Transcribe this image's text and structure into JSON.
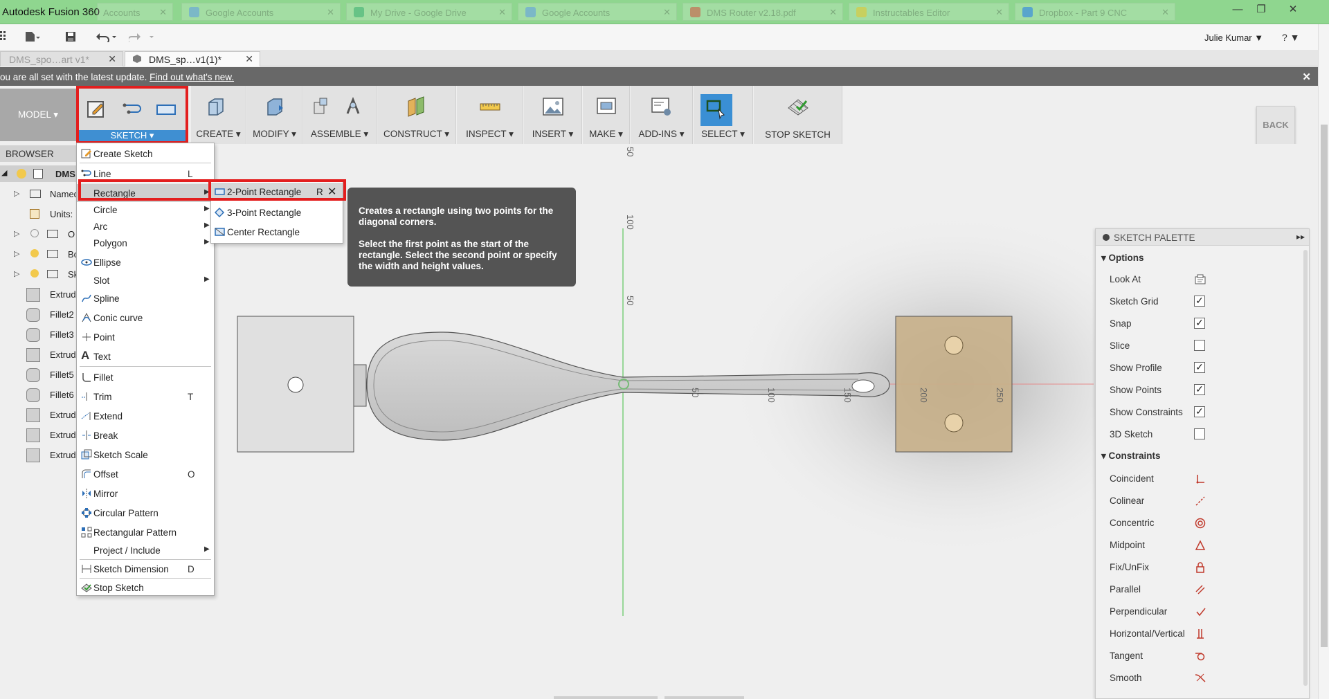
{
  "app": {
    "title": "Autodesk Fusion 360"
  },
  "browser_tabs": [
    {
      "label": "Accounts"
    },
    {
      "label": "Google Accounts"
    },
    {
      "label": "My Drive - Google Drive"
    },
    {
      "label": "Google Accounts"
    },
    {
      "label": "DMS Router v2.18.pdf"
    },
    {
      "label": "Instructables Editor"
    },
    {
      "label": "Dropbox - Part 9 CNC"
    }
  ],
  "window_buttons": {
    "minimize": "—",
    "restore": "❐",
    "close": "✕"
  },
  "quick_access": {
    "user": "Julie Kumar ▼",
    "help": "? ▼"
  },
  "document_tabs": [
    {
      "label": "DMS_spo…art v1*",
      "active": false
    },
    {
      "label": "DMS_sp…v1(1)*",
      "active": true
    }
  ],
  "notification": {
    "text": "ou are all set with the latest update.",
    "link": "Find out what's new."
  },
  "toolbar": {
    "workspace": "MODEL ▾",
    "groups": [
      {
        "id": "sketch",
        "label": "SKETCH ▾"
      },
      {
        "id": "create",
        "label": "CREATE ▾"
      },
      {
        "id": "modify",
        "label": "MODIFY ▾"
      },
      {
        "id": "assemble",
        "label": "ASSEMBLE ▾"
      },
      {
        "id": "construct",
        "label": "CONSTRUCT ▾"
      },
      {
        "id": "inspect",
        "label": "INSPECT ▾"
      },
      {
        "id": "insert",
        "label": "INSERT ▾"
      },
      {
        "id": "make",
        "label": "MAKE ▾"
      },
      {
        "id": "addins",
        "label": "ADD-INS ▾"
      },
      {
        "id": "select",
        "label": "SELECT ▾"
      },
      {
        "id": "stop",
        "label": "STOP SKETCH"
      }
    ],
    "back": "BACK"
  },
  "browser": {
    "title": "BROWSER",
    "rows": [
      {
        "label": "DMS"
      },
      {
        "label": "Named"
      },
      {
        "label": "Units:"
      },
      {
        "label": "O"
      },
      {
        "label": "Bo"
      },
      {
        "label": "Sk"
      },
      {
        "label": "Extrud"
      },
      {
        "label": "Fillet2"
      },
      {
        "label": "Fillet3"
      },
      {
        "label": "Extrud"
      },
      {
        "label": "Fillet5"
      },
      {
        "label": "Fillet6"
      },
      {
        "label": "Extrud"
      },
      {
        "label": "Extrud"
      },
      {
        "label": "Extrud"
      }
    ]
  },
  "sketch_menu": {
    "items": [
      {
        "label": "Create Sketch",
        "shortcut": ""
      },
      {
        "label": "Line",
        "shortcut": "L"
      },
      {
        "label": "Rectangle",
        "shortcut": ""
      },
      {
        "label": "Circle",
        "shortcut": ""
      },
      {
        "label": "Arc",
        "shortcut": ""
      },
      {
        "label": "Polygon",
        "shortcut": ""
      },
      {
        "label": "Ellipse",
        "shortcut": ""
      },
      {
        "label": "Slot",
        "shortcut": ""
      },
      {
        "label": "Spline",
        "shortcut": ""
      },
      {
        "label": "Conic curve",
        "shortcut": ""
      },
      {
        "label": "Point",
        "shortcut": ""
      },
      {
        "label": "Text",
        "shortcut": ""
      },
      {
        "label": "Fillet",
        "shortcut": ""
      },
      {
        "label": "Trim",
        "shortcut": "T"
      },
      {
        "label": "Extend",
        "shortcut": ""
      },
      {
        "label": "Break",
        "shortcut": ""
      },
      {
        "label": "Sketch Scale",
        "shortcut": ""
      },
      {
        "label": "Offset",
        "shortcut": "O"
      },
      {
        "label": "Mirror",
        "shortcut": ""
      },
      {
        "label": "Circular Pattern",
        "shortcut": ""
      },
      {
        "label": "Rectangular Pattern",
        "shortcut": ""
      },
      {
        "label": "Project / Include",
        "shortcut": ""
      },
      {
        "label": "Sketch Dimension",
        "shortcut": "D"
      },
      {
        "label": "Stop Sketch",
        "shortcut": ""
      }
    ]
  },
  "rectangle_submenu": {
    "items": [
      {
        "label": "2-Point Rectangle",
        "shortcut": "R"
      },
      {
        "label": "3-Point Rectangle",
        "shortcut": ""
      },
      {
        "label": "Center Rectangle",
        "shortcut": ""
      }
    ]
  },
  "tooltip": {
    "line1": "Creates a rectangle using two points for the diagonal corners.",
    "line2": "Select the first point as the start of the rectangle. Select the second point or specify the width and height values."
  },
  "canvas": {
    "ruler_labels": [
      "50",
      "100",
      "50",
      "50",
      "100",
      "150",
      "200",
      "250"
    ]
  },
  "palette": {
    "title": "SKETCH PALETTE",
    "options_title": "Options",
    "options": [
      {
        "label": "Look At",
        "checked": null
      },
      {
        "label": "Sketch Grid",
        "checked": true
      },
      {
        "label": "Snap",
        "checked": true
      },
      {
        "label": "Slice",
        "checked": false
      },
      {
        "label": "Show Profile",
        "checked": true
      },
      {
        "label": "Show Points",
        "checked": true
      },
      {
        "label": "Show Constraints",
        "checked": true
      },
      {
        "label": "3D Sketch",
        "checked": false
      }
    ],
    "constraints_title": "Constraints",
    "constraints": [
      {
        "label": "Coincident",
        "icon": "coincident-icon"
      },
      {
        "label": "Colinear",
        "icon": "colinear-icon"
      },
      {
        "label": "Concentric",
        "icon": "concentric-icon"
      },
      {
        "label": "Midpoint",
        "icon": "midpoint-icon"
      },
      {
        "label": "Fix/UnFix",
        "icon": "lock-icon"
      },
      {
        "label": "Parallel",
        "icon": "parallel-icon"
      },
      {
        "label": "Perpendicular",
        "icon": "perpendicular-icon"
      },
      {
        "label": "Horizontal/Vertical",
        "icon": "horizontal-vertical-icon"
      },
      {
        "label": "Tangent",
        "icon": "tangent-icon"
      },
      {
        "label": "Smooth",
        "icon": "smooth-icon"
      }
    ]
  },
  "colors": {
    "highlight": "#e31e1e",
    "accent": "#3a8fd4",
    "titlebar": "#8fd68f",
    "body": "#c8b08a"
  }
}
